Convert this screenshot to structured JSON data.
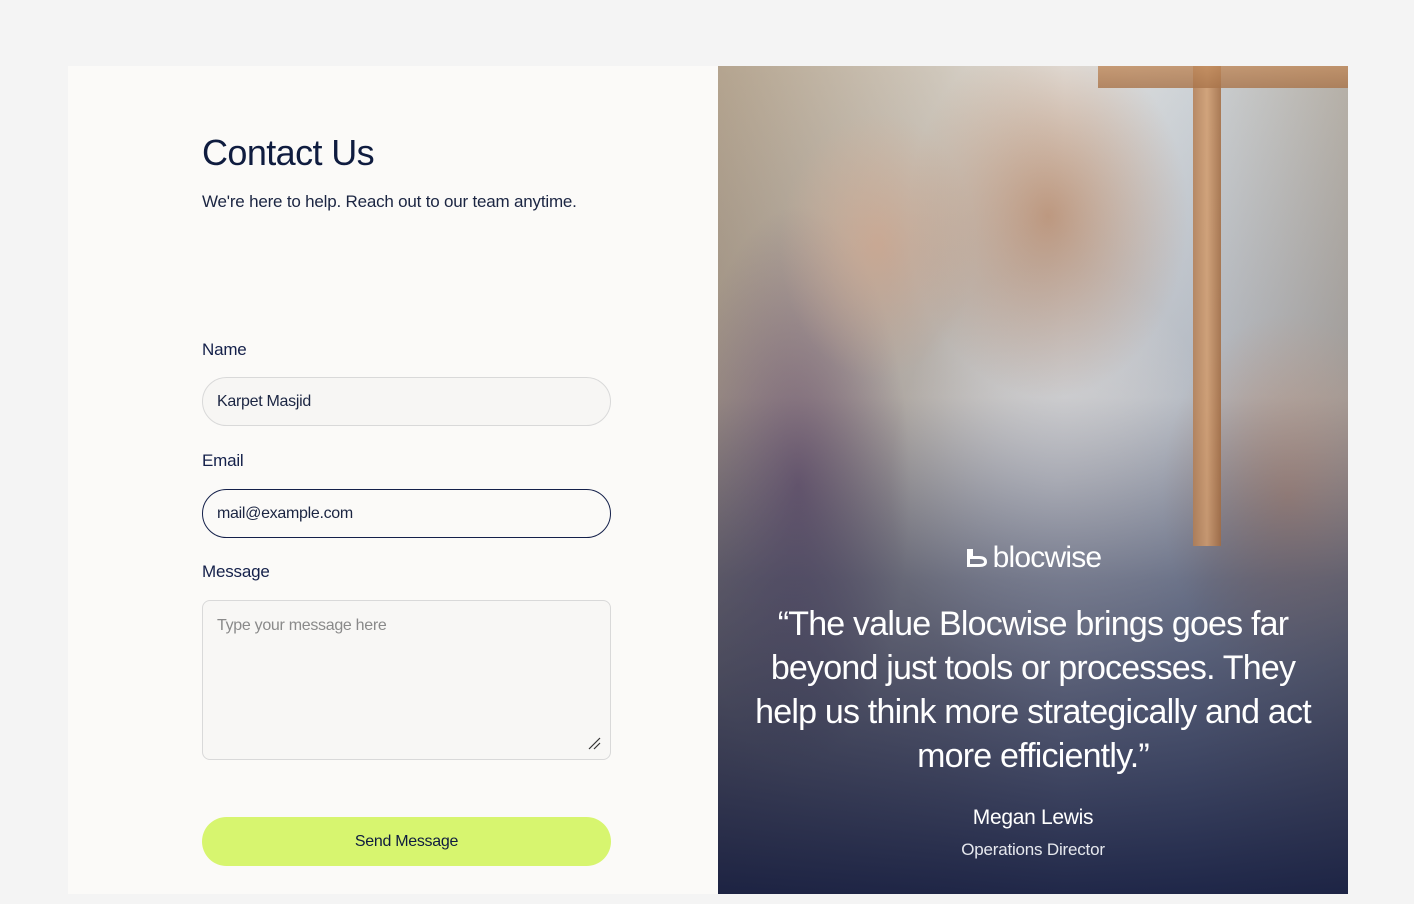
{
  "contact": {
    "title": "Contact Us",
    "subtitle": "We're here to help. Reach out to our team anytime.",
    "name_label": "Name",
    "name_value": "Karpet Masjid",
    "email_label": "Email",
    "email_value": "mail@example.com",
    "message_label": "Message",
    "message_placeholder": "Type your message here",
    "submit_label": "Send Message"
  },
  "testimonial": {
    "brand": "blocwise",
    "quote": "“The value Blocwise brings goes far beyond just tools or processes. They help us think more strategically and act more efficiently.”",
    "person": "Megan Lewis",
    "role": "Operations Director"
  },
  "colors": {
    "accent": "#d7f56f",
    "navy": "#0f1c3f",
    "page_bg": "#f4f4f4",
    "card_bg": "#fbfaf8"
  },
  "icons": {
    "brand_logo": "blocwise-logo-icon",
    "resize_handle": "resize-grip-icon"
  }
}
